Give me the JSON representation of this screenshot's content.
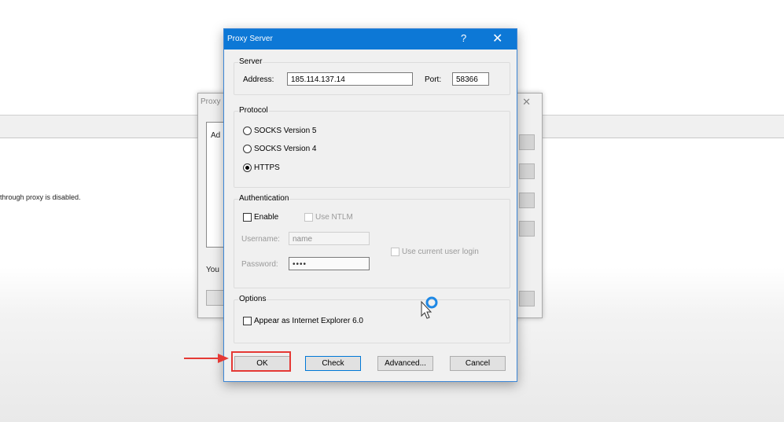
{
  "background": {
    "status_text": "through proxy is disabled."
  },
  "underlying_window": {
    "title": "Proxy",
    "panel_label": "Ad",
    "footer_text": "You"
  },
  "dialog": {
    "title": "Proxy Server",
    "help_glyph": "?",
    "close_glyph": "✕",
    "server": {
      "group_label": "Server",
      "address_label": "Address:",
      "address_value": "185.114.137.14",
      "port_label": "Port:",
      "port_value": "58366"
    },
    "protocol": {
      "group_label": "Protocol",
      "options": [
        "SOCKS Version 5",
        "SOCKS Version 4",
        "HTTPS"
      ],
      "selected": "HTTPS"
    },
    "authentication": {
      "group_label": "Authentication",
      "enable_label": "Enable",
      "enable_checked": false,
      "ntlm_label": "Use NTLM",
      "username_label": "Username:",
      "username_value": "name",
      "password_label": "Password:",
      "password_value": "••••",
      "current_user_label": "Use current user login"
    },
    "options": {
      "group_label": "Options",
      "ie6_label": "Appear as Internet Explorer 6.0",
      "ie6_checked": false
    },
    "buttons": {
      "ok": "OK",
      "check": "Check",
      "advanced": "Advanced...",
      "cancel": "Cancel"
    }
  },
  "colors": {
    "titlebar": "#0d78d6",
    "dialog_bg": "#f0f0f0",
    "highlight": "#e53935",
    "cursor_ring": "#1e88e5"
  }
}
